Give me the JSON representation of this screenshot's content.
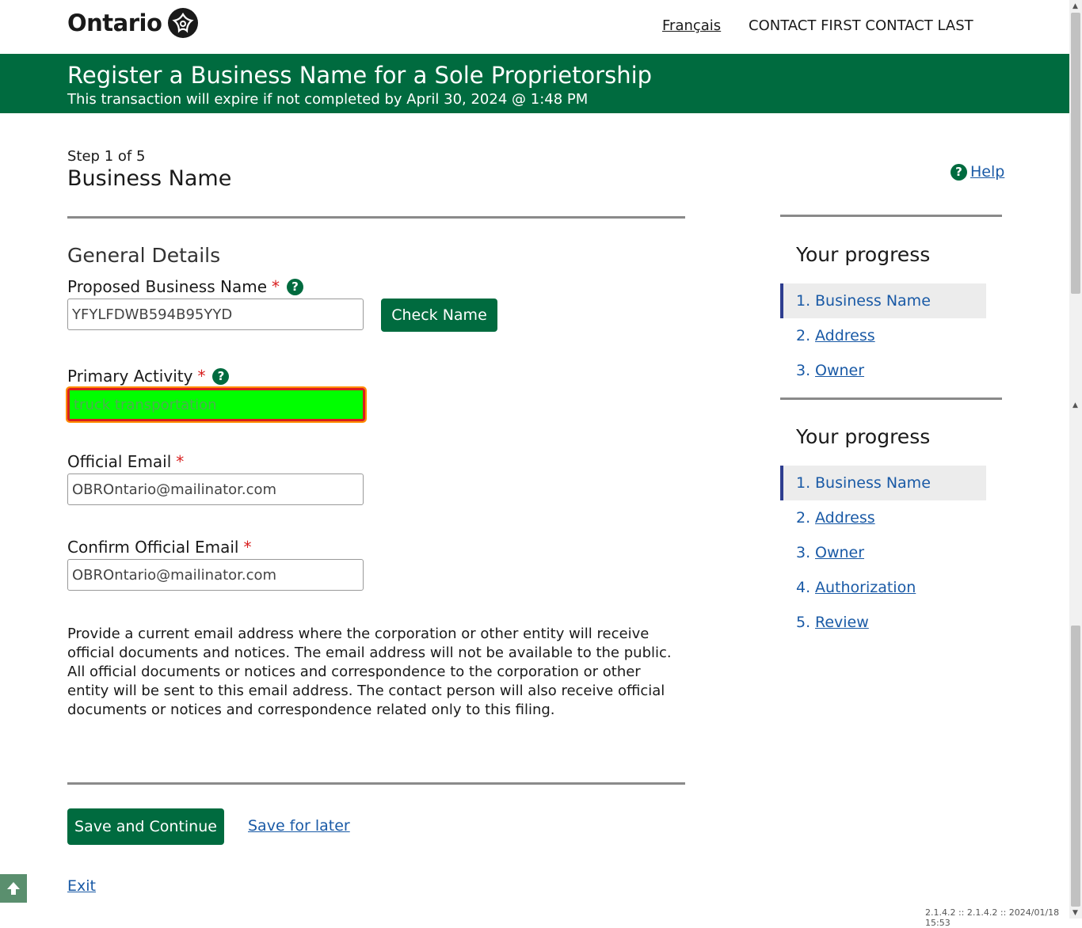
{
  "header": {
    "logo_text": "Ontario",
    "language_link": "Français",
    "user_name": "CONTACT FIRST CONTACT LAST"
  },
  "banner": {
    "title": "Register a Business Name for a Sole Proprietorship",
    "subtitle": "This transaction will expire if not completed by April 30, 2024 @ 1:48 PM"
  },
  "page": {
    "step": "Step 1 of 5",
    "title": "Business Name",
    "help_label": "Help",
    "help_icon": "?"
  },
  "form": {
    "section_title": "General Details",
    "required_mark": "*",
    "business_name_label": "Proposed Business Name",
    "business_name_value": "YFYLFDWB594B95YYD",
    "check_name_button": "Check Name",
    "primary_activity_label": "Primary Activity",
    "primary_activity_value": "truck transportation",
    "official_email_label": "Official Email",
    "official_email_value": "OBROntario@mailinator.com",
    "confirm_email_label": "Confirm Official Email",
    "confirm_email_value": "OBROntario@mailinator.com",
    "description": "Provide a current email address where the corporation or other entity will receive official documents and notices. The email address will not be available to the public. All official documents or notices and correspondence to the corporation or other entity will be sent to this email address. The contact person will also receive official documents or notices and correspondence related only to this filing.",
    "save_continue_button": "Save and Continue",
    "save_later_link": "Save for later",
    "exit_link": "Exit"
  },
  "progress_short": {
    "title": "Your progress",
    "items": [
      {
        "num": "1.",
        "label": "Business Name"
      },
      {
        "num": "2.",
        "label": "Address"
      },
      {
        "num": "3.",
        "label": "Owner"
      }
    ]
  },
  "progress_full": {
    "title": "Your progress",
    "items": [
      {
        "num": "1.",
        "label": "Business Name"
      },
      {
        "num": "2.",
        "label": "Address"
      },
      {
        "num": "3.",
        "label": "Owner"
      },
      {
        "num": "4.",
        "label": "Authorization"
      },
      {
        "num": "5.",
        "label": "Review"
      }
    ]
  },
  "footer": {
    "version": "2.1.4.2 :: 2.1.4.2 :: 2024/01/18 15:53"
  },
  "colors": {
    "brand_green": "#006b3f",
    "link_blue": "#1a5aa6",
    "required_red": "#d81e1e",
    "highlight_fill": "#00ff00"
  }
}
